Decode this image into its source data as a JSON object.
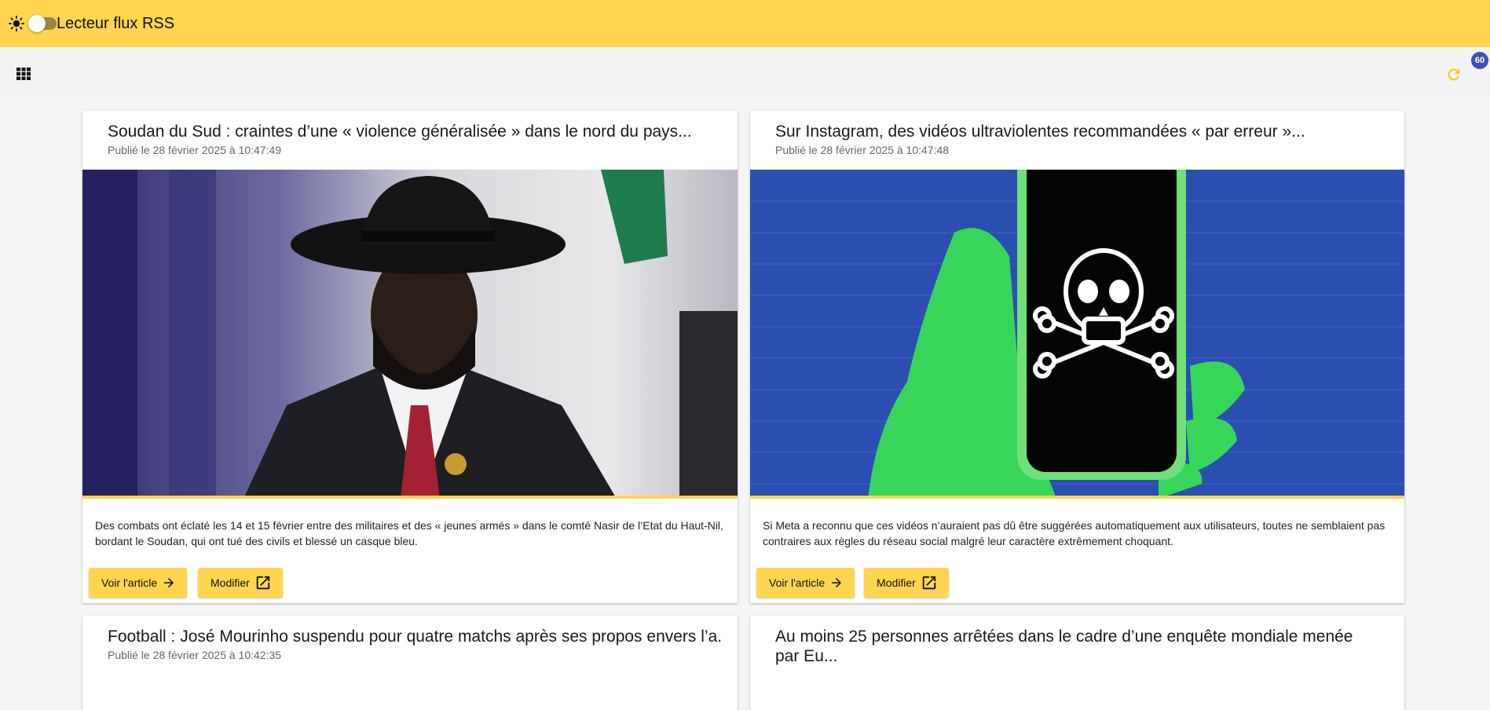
{
  "app": {
    "title": "Lecteur flux RSS",
    "accent_color": "#ffd54f",
    "badge_color": "#3f51b5",
    "theme_icon": "sun-icon"
  },
  "toolbar": {
    "view_icon": "grid-icon",
    "refresh_icon": "refresh-icon",
    "unread_count": "60"
  },
  "articles": [
    {
      "title": "Soudan du Sud : craintes d’une « violence généralisée » dans le nord du pays...",
      "date": "Publié le 28 février 2025 à 10:47:49",
      "image_icon": "photo-man-in-hat",
      "description": "Des combats ont éclaté les 14 et 15 février entre des militaires et des « jeunes armés » dans le comté Nasir de l’Etat du Haut-Nil, bordant le Soudan, qui ont tué des civils et blessé un casque bleu.",
      "read_label": "Voir l'article",
      "edit_label": "Modifier"
    },
    {
      "title": "Sur Instagram, des vidéos ultraviolentes recommandées « par erreur »...",
      "date": "Publié le 28 février 2025 à 10:47:48",
      "image_icon": "phone-skull-icon",
      "description": "Si Meta a reconnu que ces vidéos n’auraient pas dû être suggérées automatiquement aux utilisateurs, toutes ne semblaient pas contraires aux règles du réseau social malgré leur caractère extrêmement choquant.",
      "read_label": "Voir l'article",
      "edit_label": "Modifier"
    },
    {
      "title": "Football : José Mourinho suspendu pour quatre matchs après ses propos envers l’a...",
      "date": "Publié le 28 février 2025 à 10:42:35"
    },
    {
      "title": "Au moins 25 personnes arrêtées dans le cadre d’une enquête mondiale menée par Eu..."
    }
  ]
}
